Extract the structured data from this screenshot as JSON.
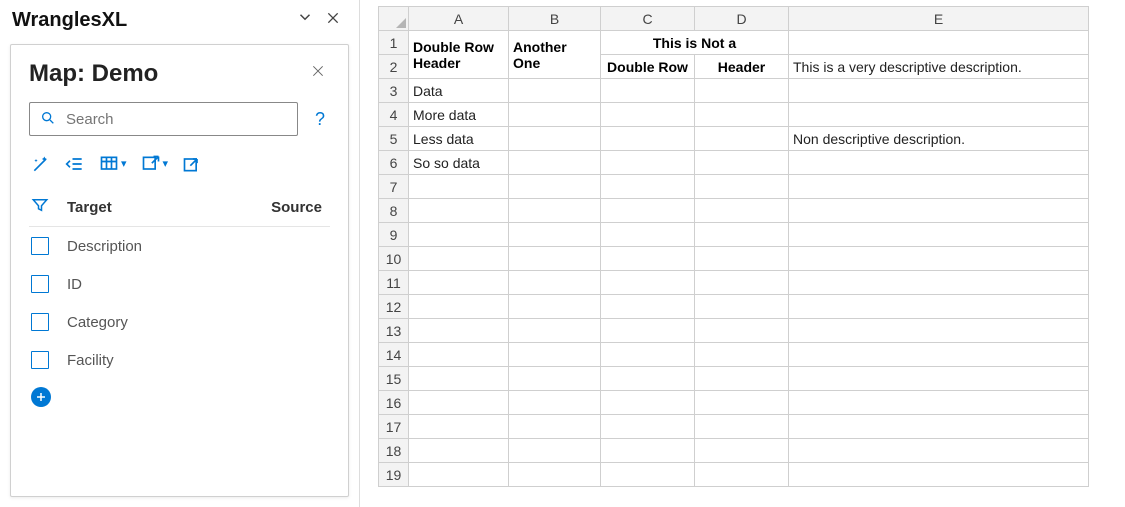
{
  "pane": {
    "app_title": "WranglesXL",
    "card_title": "Map: Demo",
    "search_placeholder": "Search",
    "list_header": {
      "target": "Target",
      "source": "Source"
    },
    "items": [
      {
        "label": "Description"
      },
      {
        "label": "ID"
      },
      {
        "label": "Category"
      },
      {
        "label": "Facility"
      }
    ]
  },
  "sheet": {
    "col_letters": [
      "A",
      "B",
      "C",
      "D",
      "E"
    ],
    "row_numbers": [
      1,
      2,
      3,
      4,
      5,
      6,
      7,
      8,
      9,
      10,
      11,
      12,
      13,
      14,
      15,
      16,
      17,
      18,
      19
    ],
    "header_row1": {
      "A_span": "Double Row Header",
      "B_span": "Another One",
      "CD_merged": "This is Not a",
      "E": ""
    },
    "header_row2": {
      "C": "Double Row",
      "D": "Header",
      "E": "This is a very descriptive description."
    },
    "data_rows": {
      "3": {
        "A": "Data"
      },
      "4": {
        "A": "More data"
      },
      "5": {
        "A": "Less data",
        "E": "Non descriptive description."
      },
      "6": {
        "A": "So so data"
      }
    }
  }
}
